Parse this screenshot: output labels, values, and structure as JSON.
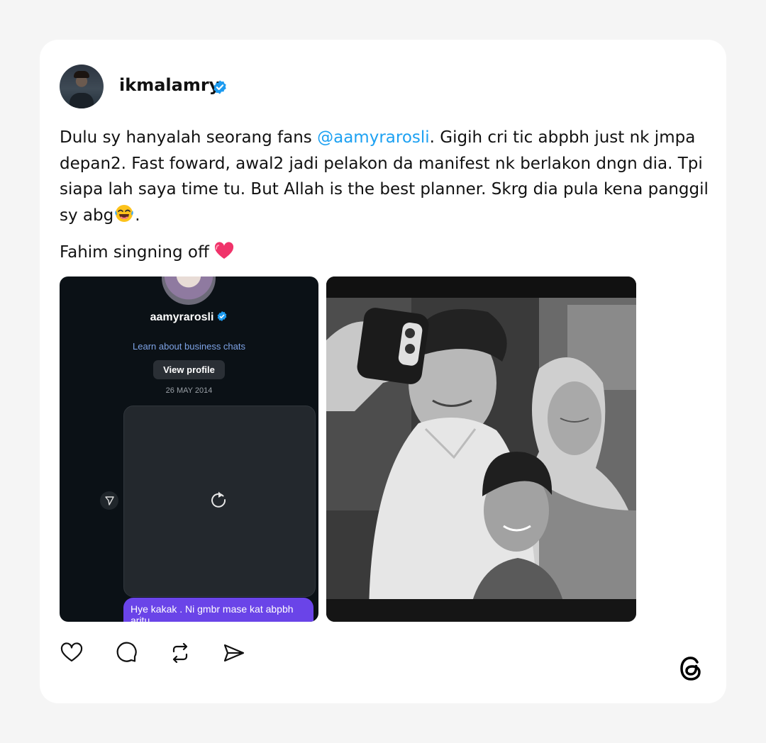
{
  "post": {
    "username": "ikmalamry",
    "text_before_mention": "Dulu sy hanyalah seorang fans ",
    "mention": "@aamyrarosli",
    "text_after_mention": ". Gigih cri tic abpbh just nk jmpa depan2. Fast foward, awal2 jadi pelakon da manifest nk berlakon dngn dia. Tpi siapa lah saya time tu. But Allah is the best planner. Skrg dia pula kena panggil sy abg",
    "text_end": ".",
    "signoff": "Fahim singning off "
  },
  "screenshot": {
    "profile_name": "aamyrarosli",
    "learn_link": "Learn about business chats",
    "view_profile": "View profile",
    "date": "26 MAY 2014",
    "message": "Hye kakak . Ni gmbr mase kat abpbh aritu"
  },
  "icons": {
    "like": "heart-icon",
    "comment": "comment-icon",
    "repost": "repost-icon",
    "share": "send-icon",
    "brand": "threads-logo"
  },
  "colors": {
    "mention": "#1da1f2",
    "verified": "#1d9bf0",
    "bubble": "#6a44e8"
  }
}
